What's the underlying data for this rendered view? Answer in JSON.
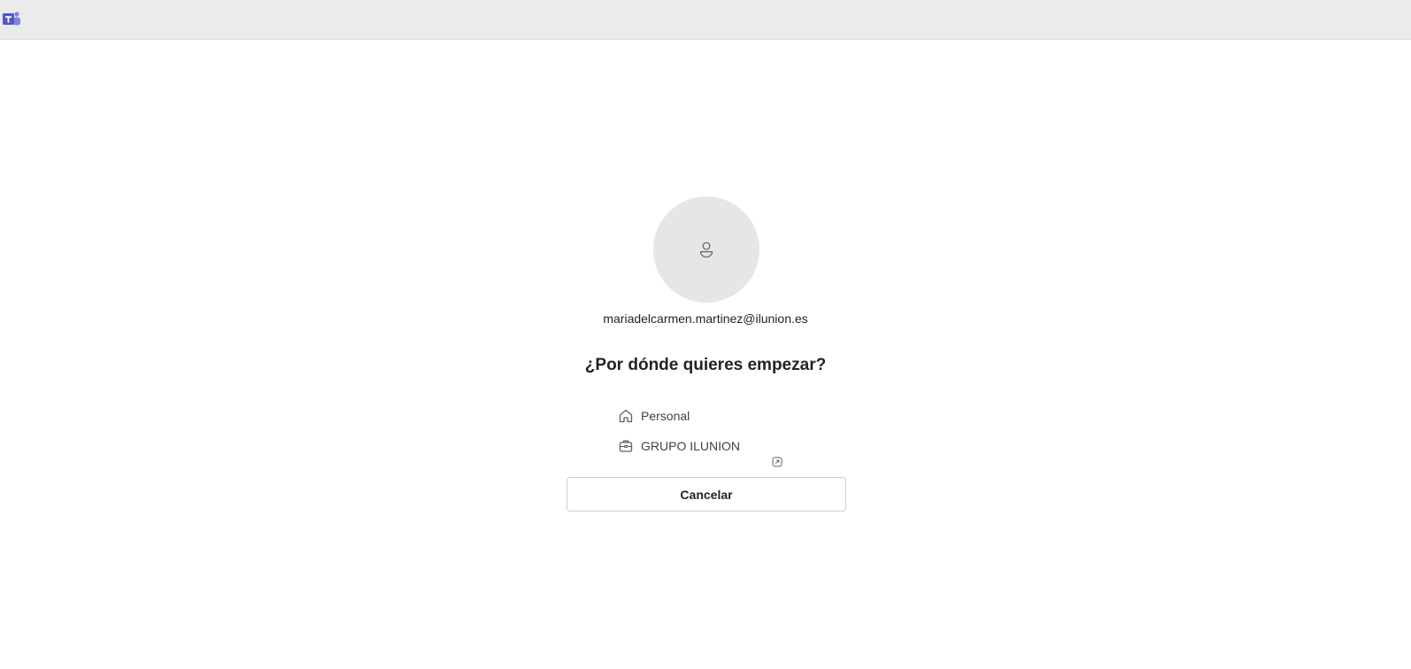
{
  "app": {
    "logo_icon": "teams-logo-icon",
    "brand_color": "#5059c9"
  },
  "account": {
    "email": "mariadelcarmen.martinez@ilunion.es",
    "avatar_icon": "person-icon"
  },
  "prompt": {
    "heading": "¿Por dónde quieres empezar?"
  },
  "options": [
    {
      "label": "Personal",
      "icon": "home-icon",
      "trailing_icon": "open-external-icon"
    },
    {
      "label": "GRUPO ILUNION",
      "icon": "briefcase-icon"
    }
  ],
  "actions": {
    "cancel_label": "Cancelar"
  }
}
